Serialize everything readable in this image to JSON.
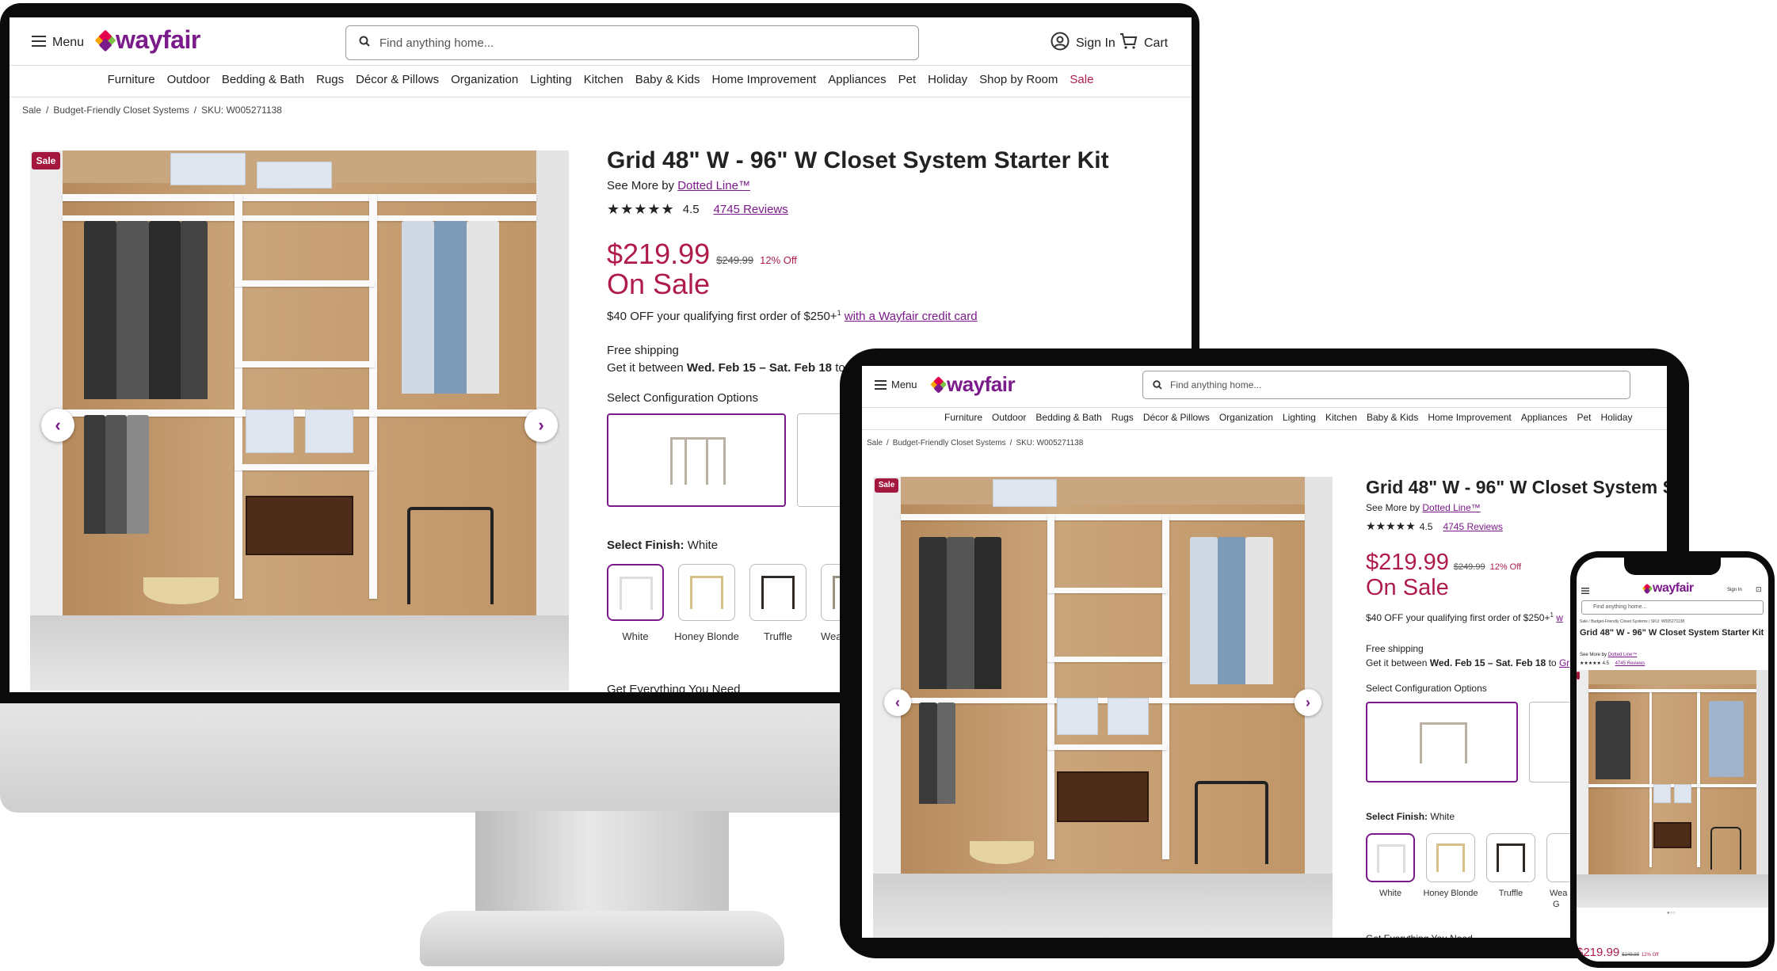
{
  "header": {
    "menu_label": "Menu",
    "logo": "wayfair",
    "search_placeholder": "Find anything home...",
    "sign_in": "Sign In",
    "cart": "Cart"
  },
  "nav": [
    "Furniture",
    "Outdoor",
    "Bedding & Bath",
    "Rugs",
    "Décor & Pillows",
    "Organization",
    "Lighting",
    "Kitchen",
    "Baby & Kids",
    "Home Improvement",
    "Appliances",
    "Pet",
    "Holiday",
    "Shop by Room",
    "Sale"
  ],
  "breadcrumb": {
    "a": "Sale",
    "b": "Budget-Friendly Closet Systems",
    "c": "SKU: W005271138"
  },
  "product": {
    "badge": "Sale",
    "title": "Grid 48\" W - 96\" W Closet System Starter Kit",
    "tablet_title": "Grid 48\" W - 96\" W Closet System S",
    "see_more": "See More by",
    "brand": "Dotted Line™",
    "rating": "4.5",
    "reviews": "4745 Reviews",
    "price": "$219.99",
    "was_price": "$249.99",
    "discount": "12% Off",
    "on_sale": "On Sale",
    "promo": "$40 OFF your qualifying first order of $250+",
    "promo_sup": "1",
    "promo_link": "with a Wayfair credit card",
    "promo_link_tablet": "w",
    "shipping": "Free shipping",
    "delivery_prefix": "Get it between",
    "delivery_dates": "Wed. Feb 15 – Sat. Feb 18",
    "delivery_to": "to",
    "delivery_link": "Gr",
    "config_label": "Select Configuration Options",
    "finish_label": "Select Finish:",
    "finish_value": "White",
    "finishes": [
      "White",
      "Honey Blonde",
      "Truffle",
      "Wea"
    ],
    "finish_tablet_4": "Wea",
    "finish_tablet_4b": "G",
    "more": "Get Everything You Need"
  },
  "colors": {
    "brand": "#7b1a8a",
    "sale": "#b01c4a",
    "badge": "#a4173e"
  },
  "icons": [
    "menu-icon",
    "search-icon",
    "account-icon",
    "cart-icon",
    "star-icon",
    "chevron-left-icon",
    "chevron-right-icon"
  ]
}
